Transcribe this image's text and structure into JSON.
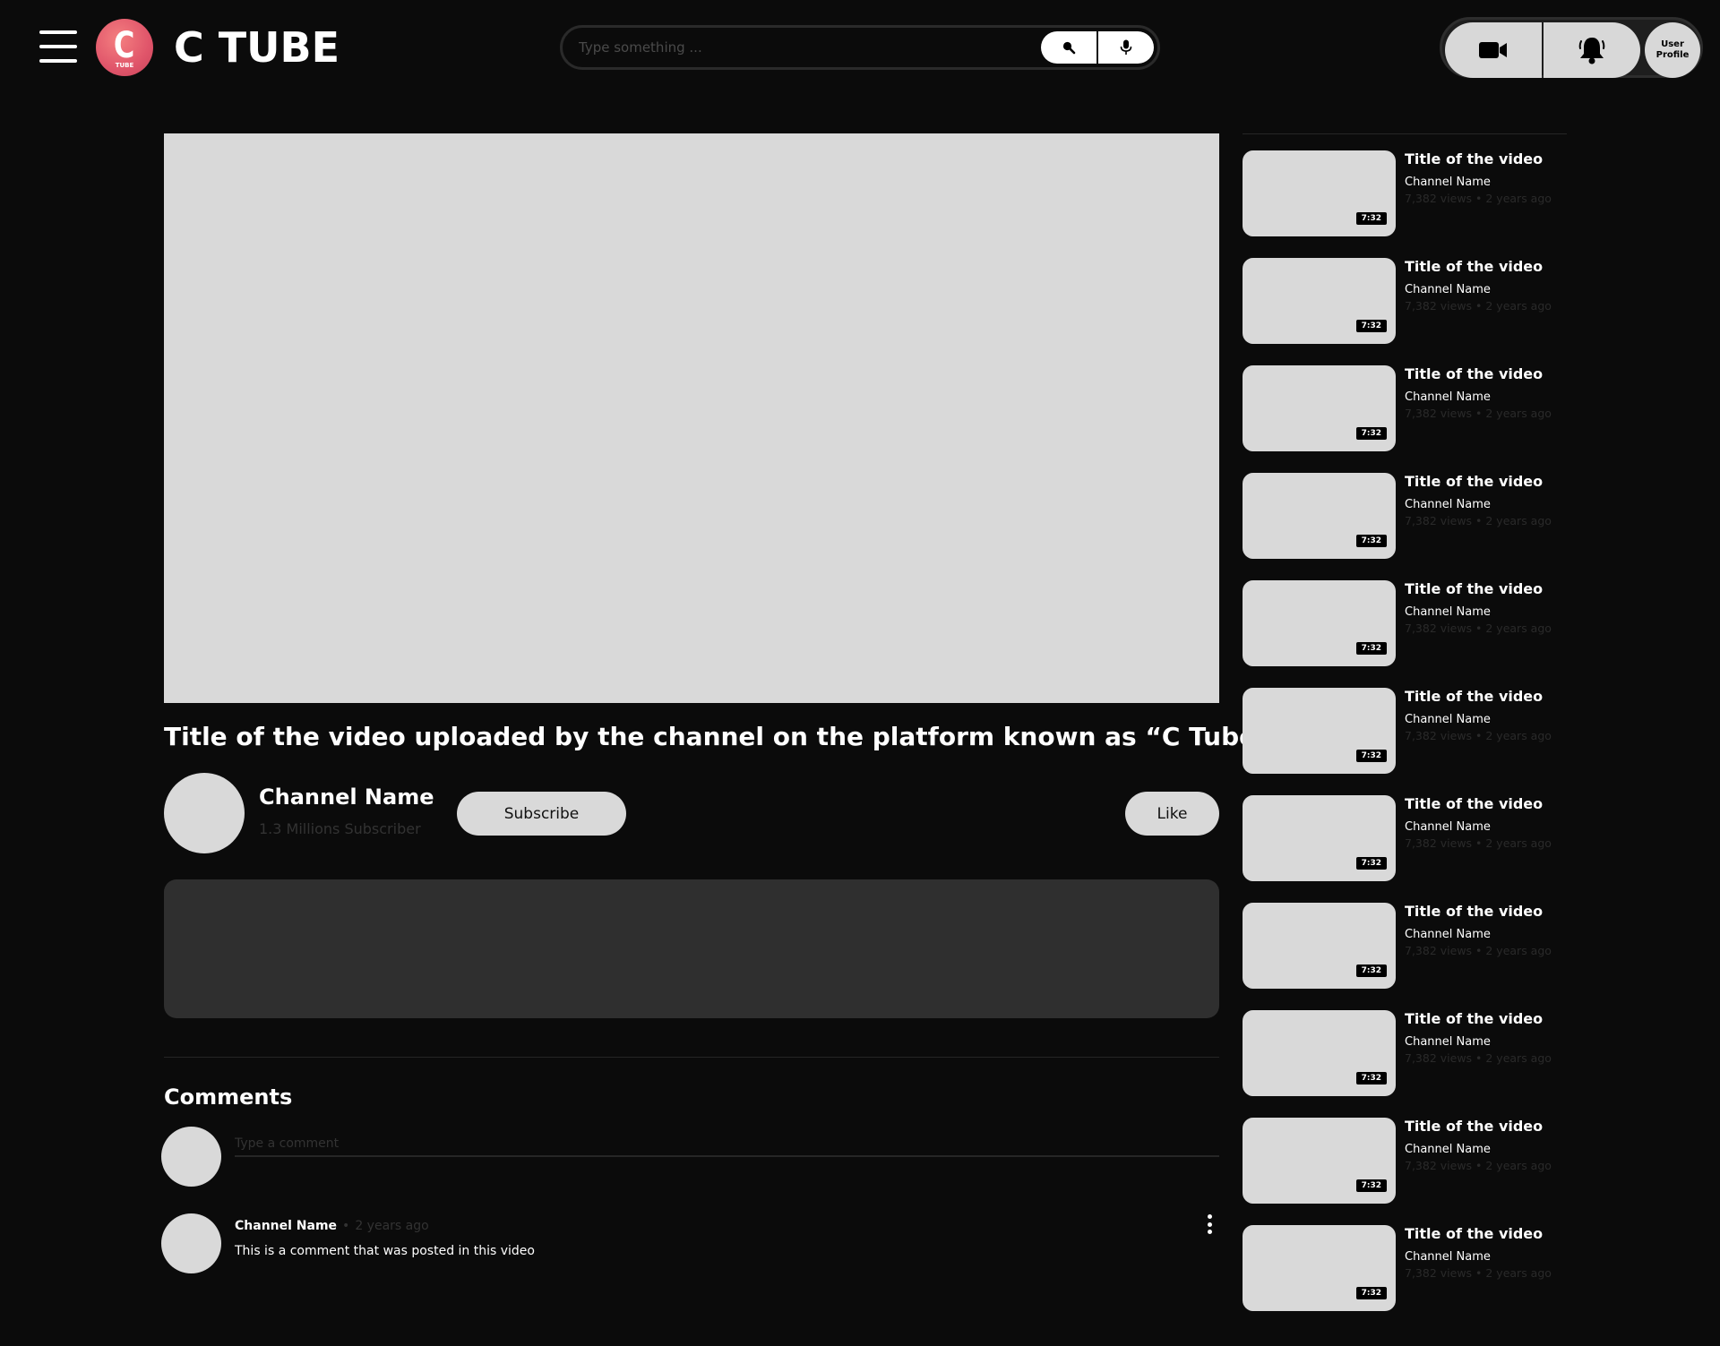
{
  "header": {
    "brand": "C TUBE",
    "logo_letter": "C",
    "logo_sub": "TUBE",
    "search_placeholder": "Type something ...",
    "user_profile_label": "User\nProfile"
  },
  "video": {
    "title": "Title of the video uploaded by the channel  on the platform known as “C Tube”",
    "channel_name": "Channel Name",
    "subscribers": "1.3 Millions Subscriber",
    "subscribe_label": "Subscribe",
    "like_label": "Like"
  },
  "comments": {
    "heading": "Comments",
    "input_placeholder": "Type a comment",
    "items": [
      {
        "author": "Channel Name",
        "dot": "•",
        "time": "2 years ago",
        "text": "This is a comment that was posted in this video"
      }
    ]
  },
  "sidebar": {
    "items": [
      {
        "title": "Title of the video",
        "channel": "Channel Name",
        "meta": "7,382 views • 2 years ago",
        "duration": "7:32"
      },
      {
        "title": "Title of the video",
        "channel": "Channel Name",
        "meta": "7,382 views • 2 years ago",
        "duration": "7:32"
      },
      {
        "title": "Title of the video",
        "channel": "Channel Name",
        "meta": "7,382 views • 2 years ago",
        "duration": "7:32"
      },
      {
        "title": "Title of the video",
        "channel": "Channel Name",
        "meta": "7,382 views • 2 years ago",
        "duration": "7:32"
      },
      {
        "title": "Title of the video",
        "channel": "Channel Name",
        "meta": "7,382 views • 2 years ago",
        "duration": "7:32"
      },
      {
        "title": "Title of the video",
        "channel": "Channel Name",
        "meta": "7,382 views • 2 years ago",
        "duration": "7:32"
      },
      {
        "title": "Title of the video",
        "channel": "Channel Name",
        "meta": "7,382 views • 2 years ago",
        "duration": "7:32"
      },
      {
        "title": "Title of the video",
        "channel": "Channel Name",
        "meta": "7,382 views • 2 years ago",
        "duration": "7:32"
      },
      {
        "title": "Title of the video",
        "channel": "Channel Name",
        "meta": "7,382 views • 2 years ago",
        "duration": "7:32"
      },
      {
        "title": "Title of the video",
        "channel": "Channel Name",
        "meta": "7,382 views • 2 years ago",
        "duration": "7:32"
      },
      {
        "title": "Title of the video",
        "channel": "Channel Name",
        "meta": "7,382 views • 2 years ago",
        "duration": "7:32"
      }
    ]
  },
  "icons": {
    "menu": "hamburger-menu-icon",
    "search": "search-icon",
    "mic": "microphone-icon",
    "upload": "video-camera-icon",
    "notifications": "bell-icon",
    "more": "more-vertical-icon"
  },
  "colors": {
    "background": "#0b0b0b",
    "placeholder_gray": "#d9d9d9",
    "description_panel": "#2f2f2f",
    "logo_accent": "#e0556a"
  }
}
